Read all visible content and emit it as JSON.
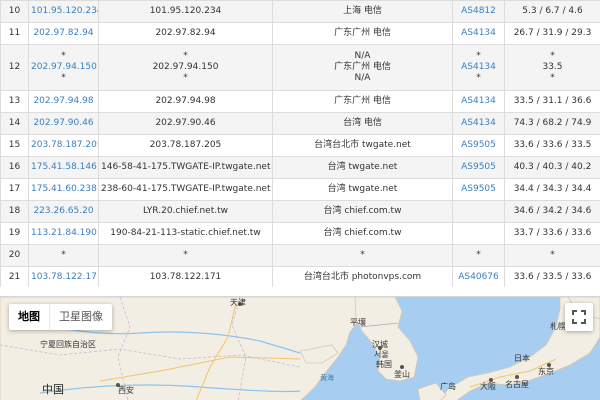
{
  "table": {
    "rows": [
      {
        "hop": "10",
        "ip": [
          "101.95.120.234"
        ],
        "host": [
          "101.95.120.234"
        ],
        "loc": [
          "上海 电信"
        ],
        "asn": [
          "AS4812"
        ],
        "time": [
          "5.3 / 6.7 / 4.6"
        ]
      },
      {
        "hop": "11",
        "ip": [
          "202.97.82.94"
        ],
        "host": [
          "202.97.82.94"
        ],
        "loc": [
          "广东广州 电信"
        ],
        "asn": [
          "AS4134"
        ],
        "time": [
          "26.7 / 31.9 / 29.3"
        ]
      },
      {
        "hop": "12",
        "ip": [
          "*",
          "202.97.94.150",
          "*"
        ],
        "host": [
          "*",
          "202.97.94.150",
          "*"
        ],
        "loc": [
          "N/A",
          "广东广州 电信",
          "N/A"
        ],
        "asn": [
          "*",
          "AS4134",
          "*"
        ],
        "time": [
          "*",
          "33.5",
          "*"
        ]
      },
      {
        "hop": "13",
        "ip": [
          "202.97.94.98"
        ],
        "host": [
          "202.97.94.98"
        ],
        "loc": [
          "广东广州 电信"
        ],
        "asn": [
          "AS4134"
        ],
        "time": [
          "33.5 / 31.1 / 36.6"
        ]
      },
      {
        "hop": "14",
        "ip": [
          "202.97.90.46"
        ],
        "host": [
          "202.97.90.46"
        ],
        "loc": [
          "台湾 电信"
        ],
        "asn": [
          "AS4134"
        ],
        "time": [
          "74.3 / 68.2 / 74.9"
        ]
      },
      {
        "hop": "15",
        "ip": [
          "203.78.187.205"
        ],
        "host": [
          "203.78.187.205"
        ],
        "loc": [
          "台湾台北市 twgate.net"
        ],
        "asn": [
          "AS9505"
        ],
        "time": [
          "33.6 / 33.6 / 33.5"
        ]
      },
      {
        "hop": "16",
        "ip": [
          "175.41.58.146"
        ],
        "host": [
          "146-58-41-175.TWGATE-IP.twgate.net"
        ],
        "loc": [
          "台湾 twgate.net"
        ],
        "asn": [
          "AS9505"
        ],
        "time": [
          "40.3 / 40.3 / 40.2"
        ]
      },
      {
        "hop": "17",
        "ip": [
          "175.41.60.238"
        ],
        "host": [
          "238-60-41-175.TWGATE-IP.twgate.net"
        ],
        "loc": [
          "台湾 twgate.net"
        ],
        "asn": [
          "AS9505"
        ],
        "time": [
          "34.4 / 34.3 / 34.4"
        ]
      },
      {
        "hop": "18",
        "ip": [
          "223.26.65.20"
        ],
        "host": [
          "LYR.20.chief.net.tw"
        ],
        "loc": [
          "台湾 chief.com.tw"
        ],
        "asn": [
          ""
        ],
        "time": [
          "34.6 / 34.2 / 34.6"
        ]
      },
      {
        "hop": "19",
        "ip": [
          "113.21.84.190"
        ],
        "host": [
          "190-84-21-113-static.chief.net.tw"
        ],
        "loc": [
          "台湾 chief.com.tw"
        ],
        "asn": [
          ""
        ],
        "time": [
          "33.7 / 33.6 / 33.6"
        ]
      },
      {
        "hop": "20",
        "ip": [
          "*"
        ],
        "host": [
          "*"
        ],
        "loc": [
          "*"
        ],
        "asn": [
          "*"
        ],
        "time": [
          "*"
        ]
      },
      {
        "hop": "21",
        "ip": [
          "103.78.122.171"
        ],
        "host": [
          "103.78.122.171"
        ],
        "loc": [
          "台湾台北市 photonvps.com"
        ],
        "asn": [
          "AS40676"
        ],
        "time": [
          "33.6 / 33.5 / 33.6"
        ]
      }
    ]
  },
  "map": {
    "type_map": "地图",
    "type_satellite": "卫星图像",
    "fullscreen_icon": "fullscreen-icon",
    "labels": {
      "tianjin": "天津",
      "china": "中国",
      "xian": "西安",
      "ningxia": "宁夏回族自治区",
      "pyongyang": "平壤",
      "seoul": "서울",
      "hancheng": "汉城",
      "korea": "韩国",
      "busan": "釜山",
      "yellow_sea": "黄海",
      "japan": "日本",
      "tokyo": "东京",
      "nagoya": "名古屋",
      "osaka": "大阪",
      "hiroshima": "广岛",
      "sapporo": "札幌"
    },
    "colors": {
      "sea": "#a7cdf0",
      "land": "#f2eee4",
      "link": "#3a7fc1"
    }
  }
}
